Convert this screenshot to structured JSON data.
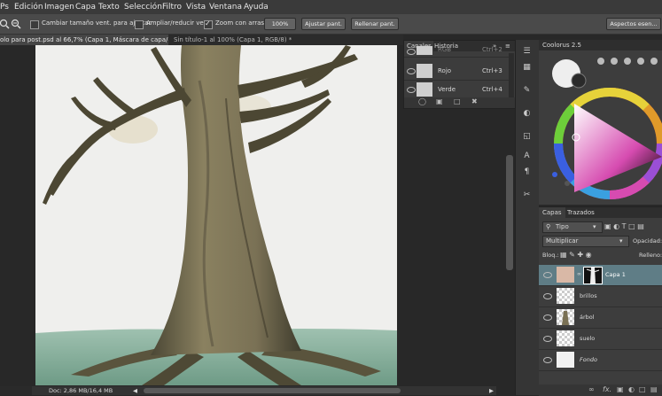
{
  "menubar": {
    "items": [
      "Edición",
      "Imagen",
      "Capa",
      "Texto",
      "Selección",
      "Filtro",
      "Vista",
      "Ventana",
      "Ayuda"
    ]
  },
  "options": {
    "resize_label": "Cambiar tamaño vent. para ajustar",
    "zoomall_label": "Ampliar/reducir vent.",
    "scrubby_label": "Zoom con arrastre",
    "zoom_value": "100%",
    "fit_label": "Ajustar pant.",
    "fill_label": "Rellenar pant.",
    "workspace_label": "Aspectos esen..."
  },
  "tabs": [
    {
      "label": "olo para post.psd al 66,7% (Capa 1, Máscara de capa/8) *"
    },
    {
      "label": "Sin título-1 al 100% (Capa 1, RGB/8) *"
    }
  ],
  "status": {
    "doc": "Doc: 2,86 MB/16,4 MB"
  },
  "channels": {
    "tabs": [
      "Canales",
      "Historia"
    ],
    "rows": [
      {
        "name": "RGB",
        "shortcut": "Ctrl+2"
      },
      {
        "name": "Rojo",
        "shortcut": "Ctrl+3"
      },
      {
        "name": "Verde",
        "shortcut": "Ctrl+4"
      }
    ]
  },
  "coolorus": {
    "title": "Coolorus 2.5"
  },
  "layers": {
    "tabs": [
      "Capas",
      "Trazados"
    ],
    "filter": "Tipo",
    "blend_mode": "Multiplicar",
    "opacity_label": "Opacidad:",
    "lock_label": "Bloq.:",
    "fill_label": "Relleno:",
    "items": [
      {
        "name": "Capa 1"
      },
      {
        "name": "brillos"
      },
      {
        "name": "árbol"
      },
      {
        "name": "suelo"
      },
      {
        "name": "Fondo"
      }
    ]
  },
  "colors": {
    "accent": "#5f7d86",
    "panel": "#3d3d3d",
    "canvas_bg": "#efefed"
  }
}
